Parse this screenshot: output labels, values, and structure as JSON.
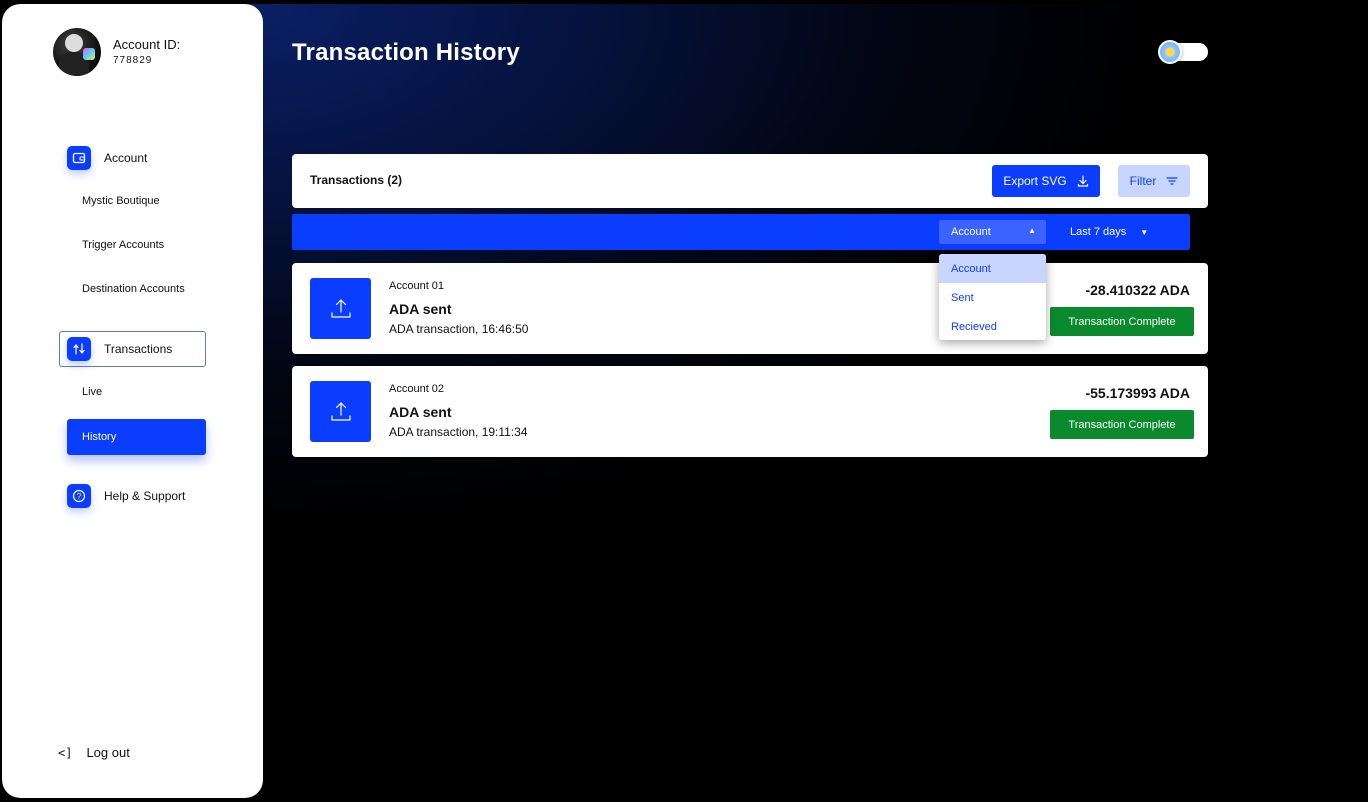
{
  "user": {
    "account_id_label": "Account ID:",
    "account_id_value": "778829"
  },
  "sidebar": {
    "account": {
      "label": "Account",
      "icon": "wallet-icon",
      "subitems": [
        "Mystic Boutique",
        "Trigger Accounts",
        "Destination Accounts"
      ]
    },
    "transactions": {
      "label": "Transactions",
      "icon": "transfer-arrows-icon",
      "subitems": [
        "Live",
        "History"
      ],
      "active_subitem": "History"
    },
    "help": {
      "label": "Help & Support",
      "icon": "question-circle-icon"
    },
    "logout_label": "Log out"
  },
  "main": {
    "title": "Transaction History",
    "theme_toggle": "day-mode-toggle",
    "transactions_header": "Transactions (2)",
    "export_label": "Export SVG",
    "filter_label": "Filter",
    "account_select": {
      "selected": "Account",
      "options": [
        "Account",
        "Sent",
        "Recieved"
      ]
    },
    "range_select": {
      "selected": "Last 7 days"
    },
    "transactions": [
      {
        "account": "Account 01",
        "title": "ADA sent",
        "subtitle": "ADA transaction, 16:46:50",
        "amount": "-28.410322 ADA",
        "status": "Transaction Complete"
      },
      {
        "account": "Account 02",
        "title": "ADA sent",
        "subtitle": "ADA transaction, 19:11:34",
        "amount": "-55.173993 ADA",
        "status": "Transaction Complete"
      }
    ]
  },
  "colors": {
    "accent": "#0b3dff",
    "accent_light": "#c8d6ff",
    "success": "#0a8a2c",
    "background_dark": "#061340"
  }
}
